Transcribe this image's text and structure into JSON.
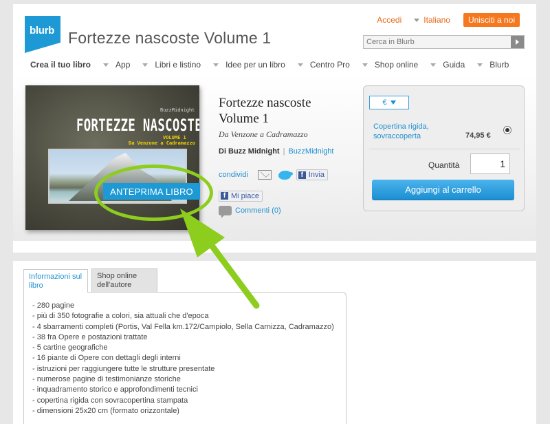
{
  "header": {
    "logo_text": "blurb",
    "site_title": "Fortezze nascoste Volume 1",
    "login": "Accedi",
    "language": "Italiano",
    "join": "Unisciti a noi",
    "search_placeholder": "Cerca in Blurb"
  },
  "nav": [
    "Crea il tuo libro",
    "App",
    "Libri e listino",
    "Idee per un libro",
    "Centro Pro",
    "Shop online",
    "Guida",
    "Blurb"
  ],
  "cover": {
    "author": "BuzzMidnight",
    "title": "FORTEZZE NASCOSTE",
    "volume": "VOLUME 1",
    "subtitle": "Da Venzone a Cadramazzo",
    "preview_button": "ANTEPRIMA LIBRO"
  },
  "book": {
    "title": "Fortezze nascoste Volume 1",
    "subtitle": "Da Venzone a Cadramazzo",
    "author": "Di Buzz Midnight",
    "username": "BuzzMidnight",
    "share_label": "condividi",
    "send_label": "Invia",
    "like_label": "Mi piace",
    "comments": "Commenti (0)"
  },
  "purchase": {
    "currency": "€",
    "option_label": "Copertina rigida, sovraccoperta",
    "price": "74,95 €",
    "quantity_label": "Quantità",
    "quantity": "1",
    "add_to_cart": "Aggiungi al carrello"
  },
  "tabs": {
    "info": "Informazioni sul libro",
    "shop": "Shop online dell'autore"
  },
  "details": [
    "- 280 pagine",
    "- più di 350 fotografie a colori, sia attuali che d'epoca",
    "- 4 sbarramenti completi (Portis, Val Fella km.172/Campiolo, Sella Carnizza, Cadramazzo)",
    "- 38 fra Opere e postazioni trattate",
    "- 5 cartine geografiche",
    "- 16 piante di Opere con dettagli degli interni",
    "- istruzioni per raggiungere tutte le strutture presentate",
    "- numerose pagine di testimonianze storiche",
    "- inquadramento storico e approfondimenti tecnici",
    "- copertina rigida con sovracopertina stampata",
    "- dimensioni 25x20 cm (formato orizzontale)"
  ],
  "colors": {
    "brand_blue": "#1d9ad6",
    "orange": "#f5781f",
    "annotation_green": "#8ccd1e"
  }
}
